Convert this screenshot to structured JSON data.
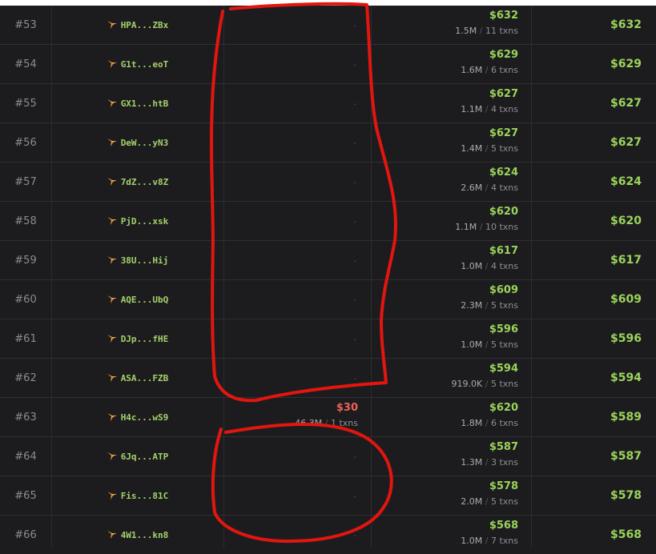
{
  "table": {
    "separator": "/",
    "txns_suffix": "txns",
    "rows": [
      {
        "rank": "#53",
        "wallet": "HPA...ZBx",
        "buy": {
          "amount": "-"
        },
        "sell": {
          "amount": "$632",
          "volume": "1.5M",
          "txns": "11"
        },
        "pnl": "$632"
      },
      {
        "rank": "#54",
        "wallet": "G1t...eoT",
        "buy": {
          "amount": "-"
        },
        "sell": {
          "amount": "$629",
          "volume": "1.6M",
          "txns": "6"
        },
        "pnl": "$629"
      },
      {
        "rank": "#55",
        "wallet": "GX1...htB",
        "buy": {
          "amount": "-"
        },
        "sell": {
          "amount": "$627",
          "volume": "1.1M",
          "txns": "4"
        },
        "pnl": "$627"
      },
      {
        "rank": "#56",
        "wallet": "DeW...yN3",
        "buy": {
          "amount": "-"
        },
        "sell": {
          "amount": "$627",
          "volume": "1.4M",
          "txns": "5"
        },
        "pnl": "$627"
      },
      {
        "rank": "#57",
        "wallet": "7dZ...v8Z",
        "buy": {
          "amount": "-"
        },
        "sell": {
          "amount": "$624",
          "volume": "2.6M",
          "txns": "4"
        },
        "pnl": "$624"
      },
      {
        "rank": "#58",
        "wallet": "PjD...xsk",
        "buy": {
          "amount": "-"
        },
        "sell": {
          "amount": "$620",
          "volume": "1.1M",
          "txns": "10"
        },
        "pnl": "$620"
      },
      {
        "rank": "#59",
        "wallet": "38U...Hij",
        "buy": {
          "amount": "-"
        },
        "sell": {
          "amount": "$617",
          "volume": "1.0M",
          "txns": "4"
        },
        "pnl": "$617"
      },
      {
        "rank": "#60",
        "wallet": "AQE...UbQ",
        "buy": {
          "amount": "-"
        },
        "sell": {
          "amount": "$609",
          "volume": "2.3M",
          "txns": "5"
        },
        "pnl": "$609"
      },
      {
        "rank": "#61",
        "wallet": "DJp...fHE",
        "buy": {
          "amount": "-"
        },
        "sell": {
          "amount": "$596",
          "volume": "1.0M",
          "txns": "5"
        },
        "pnl": "$596"
      },
      {
        "rank": "#62",
        "wallet": "ASA...FZB",
        "buy": {
          "amount": "-"
        },
        "sell": {
          "amount": "$594",
          "volume": "919.0K",
          "txns": "5"
        },
        "pnl": "$594"
      },
      {
        "rank": "#63",
        "wallet": "H4c...wS9",
        "buy": {
          "amount": "$30",
          "volume": "46.3M",
          "txns": "1"
        },
        "sell": {
          "amount": "$620",
          "volume": "1.8M",
          "txns": "6"
        },
        "pnl": "$589"
      },
      {
        "rank": "#64",
        "wallet": "6Jq...ATP",
        "buy": {
          "amount": "-"
        },
        "sell": {
          "amount": "$587",
          "volume": "1.3M",
          "txns": "3"
        },
        "pnl": "$587"
      },
      {
        "rank": "#65",
        "wallet": "Fis...81C",
        "buy": {
          "amount": "-"
        },
        "sell": {
          "amount": "$578",
          "volume": "2.0M",
          "txns": "5"
        },
        "pnl": "$578"
      },
      {
        "rank": "#66",
        "wallet": "4W1...kn8",
        "buy": {
          "amount": "-"
        },
        "sell": {
          "amount": "$568",
          "volume": "1.0M",
          "txns": "7"
        },
        "pnl": "$568"
      }
    ]
  },
  "colors": {
    "background": "#1c1c1f",
    "profit_green": "#9bd35a",
    "buy_red": "#f0605a",
    "wallet_green": "#a5d16a",
    "wallet_icon_orange": "#f2a03d",
    "annotation_red": "#e3150f"
  },
  "icons": {
    "wallet": "wallet-bird-icon"
  }
}
